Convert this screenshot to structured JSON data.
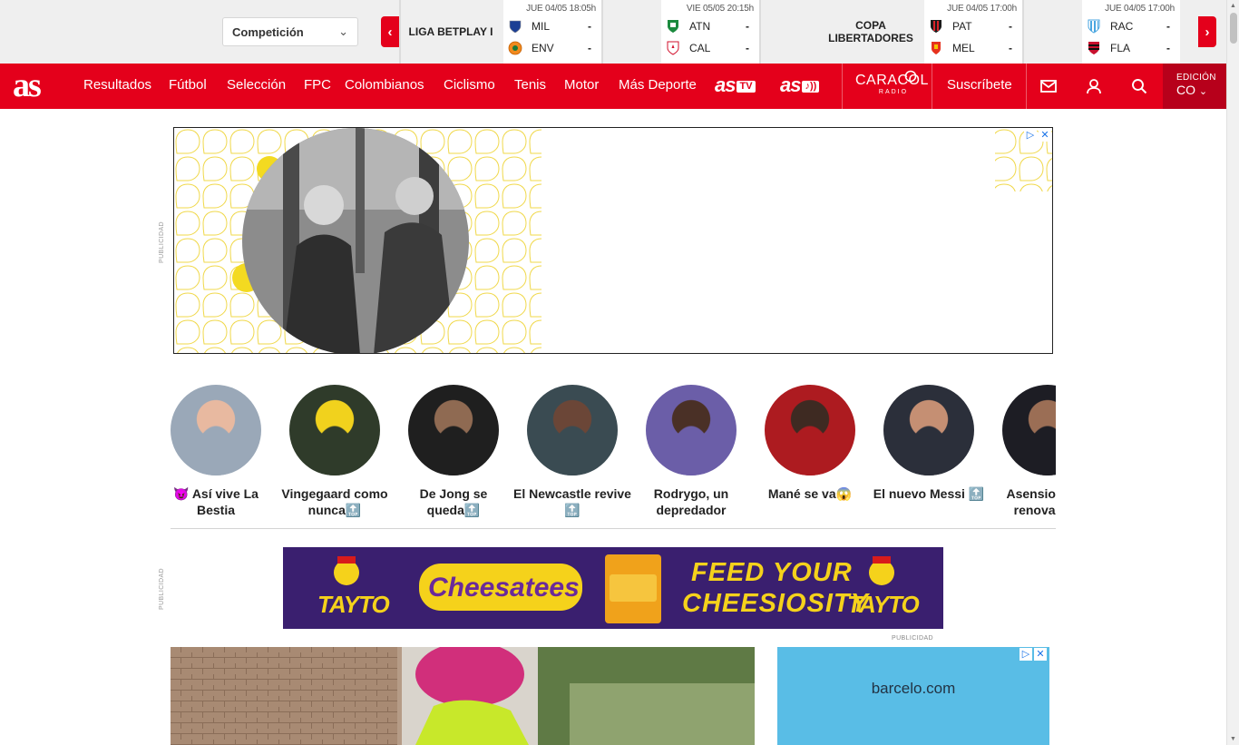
{
  "scoreboard": {
    "competition_select": "Competición",
    "prev_label": "‹",
    "next_label": "›",
    "groups": [
      {
        "label": "LIGA BETPLAY I",
        "matches": [
          {
            "time": "JUE 04/05 18:05h",
            "home": {
              "abbr": "MIL",
              "score": "-"
            },
            "away": {
              "abbr": "ENV",
              "score": "-"
            }
          },
          {
            "time": "VIE 05/05 20:15h",
            "home": {
              "abbr": "ATN",
              "score": "-"
            },
            "away": {
              "abbr": "CAL",
              "score": "-"
            }
          }
        ]
      },
      {
        "label": "COPA LIBERTADORES",
        "matches": [
          {
            "time": "JUE 04/05 17:00h",
            "home": {
              "abbr": "PAT",
              "score": "-"
            },
            "away": {
              "abbr": "MEL",
              "score": "-"
            }
          },
          {
            "time": "JUE 04/05 17:00h",
            "home": {
              "abbr": "RAC",
              "score": "-"
            },
            "away": {
              "abbr": "FLA",
              "score": "-"
            }
          }
        ]
      }
    ]
  },
  "nav": {
    "logo": "as",
    "items": [
      "Resultados",
      "Fútbol",
      "Selección",
      "FPC",
      "Colombianos",
      "Ciclismo",
      "Tenis",
      "Motor",
      "Más Deporte"
    ],
    "as_tv": {
      "main": "as",
      "tag": "TV"
    },
    "as_audio": {
      "main": "as",
      "tag": "♪))"
    },
    "caracol": {
      "name": "CARACOL",
      "sub": "RADIO"
    },
    "subscribe": "Suscríbete",
    "edition_label": "EDICIÓN",
    "edition_value": "CO",
    "icons": [
      "mail-icon",
      "user-icon",
      "search-icon"
    ]
  },
  "ads": {
    "label": "PUBLICIDAD",
    "leaderboard_controls": [
      "▷",
      "✕"
    ],
    "banner": {
      "brand": "TAYTO",
      "product": "Cheesatees",
      "headline_1": "FEED YOUR",
      "headline_2": "CHEESIOSITY"
    },
    "side": {
      "domain": "barcelo.com",
      "controls": [
        "▷",
        "✕"
      ]
    }
  },
  "stories": [
    {
      "caption": "😈 Así vive La Bestia",
      "colors": [
        "#9aa8b8",
        "#e8b9a0"
      ]
    },
    {
      "caption": "Vingegaard como nunca🔝",
      "colors": [
        "#2f3b2a",
        "#f1d21d"
      ]
    },
    {
      "caption": "De Jong se queda🔝",
      "colors": [
        "#1f1f1f",
        "#8f6a52"
      ]
    },
    {
      "caption": "El Newcastle revive 🔝",
      "colors": [
        "#3a4b52",
        "#6b4637"
      ]
    },
    {
      "caption": "Rodrygo, un depredador",
      "colors": [
        "#6b5ea8",
        "#4a3026"
      ]
    },
    {
      "caption": "Mané se va😱",
      "colors": [
        "#ad1b20",
        "#3e2a22"
      ]
    },
    {
      "caption": "El nuevo Messi 🔝",
      "colors": [
        "#2b2f3a",
        "#c58f73"
      ]
    },
    {
      "caption": "Asensio gana renovación",
      "colors": [
        "#1d1d24",
        "#9b6e55"
      ]
    }
  ]
}
